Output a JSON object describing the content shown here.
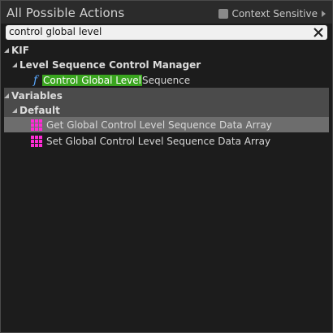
{
  "header": {
    "title": "All Possible Actions",
    "context_sensitive_label": "Context Sensitive"
  },
  "search": {
    "value": "control global level"
  },
  "tree": {
    "root_category": "KIF",
    "subcategory": "Level Sequence Control Manager",
    "function": {
      "match_text": "Control Global Level",
      "rest_text": " Sequence",
      "icon": "function-icon"
    },
    "variables_category": "Variables",
    "default_category": "Default",
    "variables": [
      {
        "label": "Get Global Control Level Sequence Data Array",
        "icon": "array-grid-icon"
      },
      {
        "label": "Set Global Control Level Sequence Data Array",
        "icon": "array-grid-icon"
      }
    ]
  },
  "colors": {
    "highlight": "#3aa51f",
    "function_icon": "#5aa9ff",
    "array_icon": "#ff2bd6"
  }
}
